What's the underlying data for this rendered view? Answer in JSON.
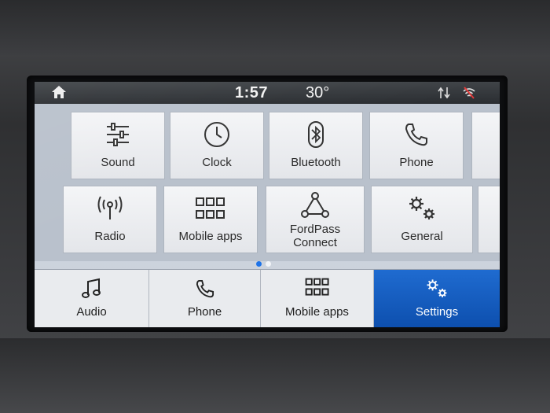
{
  "status": {
    "time": "1:57",
    "temperature": "30°",
    "home_icon": "home-icon",
    "icons": [
      "signal-transfer-icon",
      "wifi-off-icon"
    ]
  },
  "tiles": [
    {
      "label": "Sound",
      "icon": "sliders-icon"
    },
    {
      "label": "Clock",
      "icon": "clock-icon"
    },
    {
      "label": "Bluetooth",
      "icon": "bluetooth-icon"
    },
    {
      "label": "Phone",
      "icon": "phone-icon"
    },
    {
      "label": "Radio",
      "icon": "radio-antenna-icon"
    },
    {
      "label": "Mobile apps",
      "icon": "app-grid-icon"
    },
    {
      "label": "FordPass\nConnect",
      "icon": "network-icon"
    },
    {
      "label": "General",
      "icon": "gears-icon"
    }
  ],
  "pager": {
    "pages": 2,
    "current": 1,
    "active_color": "#1e73e8",
    "inactive_color": "#f2f4f7"
  },
  "bottom_nav": [
    {
      "label": "Audio",
      "icon": "music-note-icon",
      "active": false
    },
    {
      "label": "Phone",
      "icon": "phone-icon",
      "active": false
    },
    {
      "label": "Mobile apps",
      "icon": "app-grid-icon",
      "active": false
    },
    {
      "label": "Settings",
      "icon": "gears-icon",
      "active": true
    }
  ],
  "colors": {
    "accent": "#1565c8",
    "tile_bg": "#eef0f3",
    "text": "#222222"
  }
}
